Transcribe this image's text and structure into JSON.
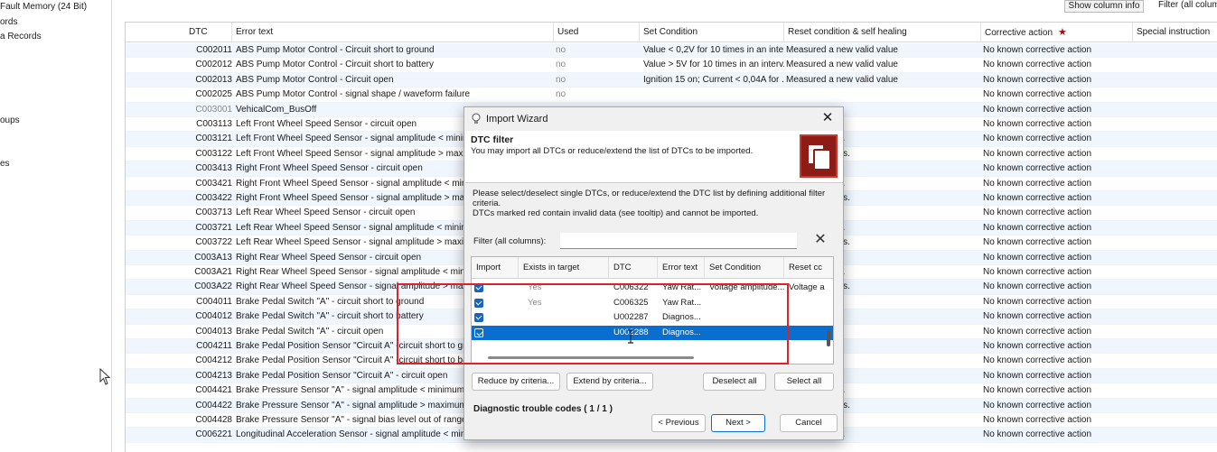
{
  "sidebar": {
    "items": [
      {
        "label": "Fault Memory (24 Bit)"
      },
      {
        "label": "ords"
      },
      {
        "label": "a Records"
      },
      {
        "label": "oups"
      },
      {
        "label": "es"
      }
    ]
  },
  "toolbar": {
    "show_column_info": "Show column info",
    "filter_label": "Filter (all columns)"
  },
  "grid": {
    "columns": {
      "dtc": "DTC",
      "error_text": "Error text",
      "used": "Used",
      "set_condition": "Set Condition",
      "reset_condition": "Reset condition & self healing",
      "corrective_action": "Corrective action",
      "corrective_marker": "★",
      "special_instruction": "Special instruction"
    },
    "rows": [
      {
        "dtc": "C002011",
        "err": "ABS Pump Motor Control - Circuit short to ground",
        "used": "no",
        "set": "Value < 0,2V for 10 times in an inte...",
        "reset": "Measured a new valid value",
        "corr": "No known corrective action"
      },
      {
        "dtc": "C002012",
        "err": "ABS Pump Motor Control - Circuit short to battery",
        "used": "no",
        "set": "Value > 5V for 10 times in an interv...",
        "reset": "Measured a new valid value",
        "corr": "No known corrective action"
      },
      {
        "dtc": "C002013",
        "err": "ABS Pump Motor Control - Circuit open",
        "used": "no",
        "set": "Ignition 15 on; Current < 0,04A for ...",
        "reset": "Measured a new valid value",
        "corr": "No known corrective action"
      },
      {
        "dtc": "C002025",
        "err": "ABS Pump Motor Control - signal shape / waveform failure",
        "used": "no",
        "set": "",
        "reset": "",
        "corr": "No known corrective action"
      },
      {
        "dtc": "C003001",
        "err": "VehicalCom_BusOff",
        "used": "",
        "set": "",
        "reset": "",
        "corr": "No known corrective action"
      },
      {
        "dtc": "C003113",
        "err": "Left Front Wheel Speed Sensor - circuit open",
        "used": "",
        "set": "",
        "reset": "valid value",
        "corr": "No known corrective action"
      },
      {
        "dtc": "C003121",
        "err": "Left Front Wheel Speed Sensor - signal amplitude < minimum",
        "used": "",
        "set": "",
        "reset": "e > 2V for 10s.",
        "corr": "No known corrective action"
      },
      {
        "dtc": "C003122",
        "err": "Left Front Wheel Speed Sensor - signal amplitude > maximum",
        "used": "",
        "set": "",
        "reset": "e < 15V for 10s.",
        "corr": "No known corrective action"
      },
      {
        "dtc": "C003413",
        "err": "Right Front Wheel Speed Sensor - circuit open",
        "used": "",
        "set": "",
        "reset": "valid value",
        "corr": "No known corrective action"
      },
      {
        "dtc": "C003421",
        "err": "Right Front Wheel Speed Sensor - signal amplitude < minimum",
        "used": "",
        "set": "",
        "reset": "e > 2V for 10s.",
        "corr": "No known corrective action"
      },
      {
        "dtc": "C003422",
        "err": "Right Front Wheel Speed Sensor - signal amplitude > maximum",
        "used": "",
        "set": "",
        "reset": "e < 15V for 10s.",
        "corr": "No known corrective action"
      },
      {
        "dtc": "C003713",
        "err": "Left Rear Wheel Speed Sensor - circuit open",
        "used": "",
        "set": "",
        "reset": "valid value",
        "corr": "No known corrective action"
      },
      {
        "dtc": "C003721",
        "err": "Left Rear Wheel Speed Sensor - signal amplitude < minimum",
        "used": "",
        "set": "",
        "reset": "e > 2V for 10s.",
        "corr": "No known corrective action"
      },
      {
        "dtc": "C003722",
        "err": "Left Rear Wheel Speed Sensor - signal amplitude > maximum",
        "used": "",
        "set": "",
        "reset": "e < 15V for 10s.",
        "corr": "No known corrective action"
      },
      {
        "dtc": "C003A13",
        "err": "Right Rear Wheel Speed Sensor - circuit open",
        "used": "",
        "set": "",
        "reset": "valid value",
        "corr": "No known corrective action"
      },
      {
        "dtc": "C003A21",
        "err": "Right Rear Wheel Speed Sensor - signal amplitude < minimum",
        "used": "",
        "set": "",
        "reset": "e > 2V for 10s.",
        "corr": "No known corrective action"
      },
      {
        "dtc": "C003A22",
        "err": "Right Rear Wheel Speed Sensor - signal amplitude > maximum",
        "used": "",
        "set": "",
        "reset": "e < 15V for 10s.",
        "corr": "No known corrective action"
      },
      {
        "dtc": "C004011",
        "err": "Brake Pedal Switch \"A\" - circuit short to ground",
        "used": "",
        "set": "",
        "reset": "valid value",
        "corr": "No known corrective action"
      },
      {
        "dtc": "C004012",
        "err": "Brake Pedal Switch \"A\" - circuit short to battery",
        "used": "",
        "set": "",
        "reset": "valid value",
        "corr": "No known corrective action"
      },
      {
        "dtc": "C004013",
        "err": "Brake Pedal Switch \"A\" - circuit open",
        "used": "",
        "set": "",
        "reset": "valid value",
        "corr": "No known corrective action"
      },
      {
        "dtc": "C004211",
        "err": "Brake Pedal Position Sensor \"Circuit A\" -circuit short to ground",
        "used": "",
        "set": "",
        "reset": "valid value",
        "corr": "No known corrective action"
      },
      {
        "dtc": "C004212",
        "err": "Brake Pedal Position Sensor \"Circuit A\" -circuit short to batte",
        "used": "",
        "set": "",
        "reset": "valid value",
        "corr": "No known corrective action"
      },
      {
        "dtc": "C004213",
        "err": "Brake Pedal Position Sensor \"Circuit A\" - circuit open",
        "used": "",
        "set": "",
        "reset": "valid value",
        "corr": "No known corrective action"
      },
      {
        "dtc": "C004421",
        "err": "Brake Pressure Sensor \"A\" - signal amplitude < minimum",
        "used": "",
        "set": "",
        "reset": "e > 2V for 10s.",
        "corr": "No known corrective action"
      },
      {
        "dtc": "C004422",
        "err": "Brake Pressure Sensor \"A\" - signal amplitude > maximum",
        "used": "",
        "set": "",
        "reset": "e < 15V for 10s.",
        "corr": "No known corrective action"
      },
      {
        "dtc": "C004428",
        "err": "Brake Pressure Sensor \"A\" - signal bias level out of range / ze",
        "used": "",
        "set": "",
        "reset": "valid value",
        "corr": "No known corrective action"
      },
      {
        "dtc": "C006221",
        "err": "Longitudinal Acceleration Sensor - signal amplitude < minimum",
        "used": "",
        "set": "",
        "reset": "e > 2V for 10s.",
        "corr": "No known corrective action"
      }
    ]
  },
  "dialog": {
    "title": "Import Wizard",
    "close": "✕",
    "heading": "DTC filter",
    "subheading": "You may import all DTCs or reduce/extend the list of DTCs to be imported.",
    "instruction_line1": "Please select/deselect single DTCs, or reduce/extend the DTC list by defining additional filter criteria.",
    "instruction_line2": "DTCs marked red contain invalid data (see tooltip) and cannot be imported.",
    "filter_label": "Filter (all columns):",
    "filter_value": "",
    "clear": "✕",
    "columns": {
      "import": "Import",
      "exists": "Exists in target",
      "dtc": "DTC",
      "error_text": "Error text",
      "set_condition": "Set Condition",
      "reset": "Reset cc"
    },
    "rows": [
      {
        "exists": "Yes",
        "dtc": "C006322",
        "err": "Yaw Rat...",
        "set": "Voltage amplitude...",
        "reset": "Voltage a"
      },
      {
        "exists": "Yes",
        "dtc": "C006325",
        "err": "Yaw Rat...",
        "set": "",
        "reset": ""
      },
      {
        "exists": "",
        "dtc": "U002287",
        "err": "Diagnos...",
        "set": "",
        "reset": ""
      },
      {
        "exists": "",
        "dtc": "U002288",
        "err": "Diagnos...",
        "set": "",
        "reset": ""
      }
    ],
    "buttons": {
      "reduce": "Reduce by criteria...",
      "extend": "Extend by criteria...",
      "deselect_all": "Deselect all",
      "select_all": "Select all",
      "previous": "< Previous",
      "next": "Next >",
      "cancel": "Cancel"
    },
    "count_label": "Diagnostic trouble codes ( 1 / 1 )"
  },
  "colors": {
    "selection": "#0a6ed1",
    "highlight_box": "#e0202a",
    "logo": "#8e1c16",
    "row_alt": "#f0f6fd"
  }
}
